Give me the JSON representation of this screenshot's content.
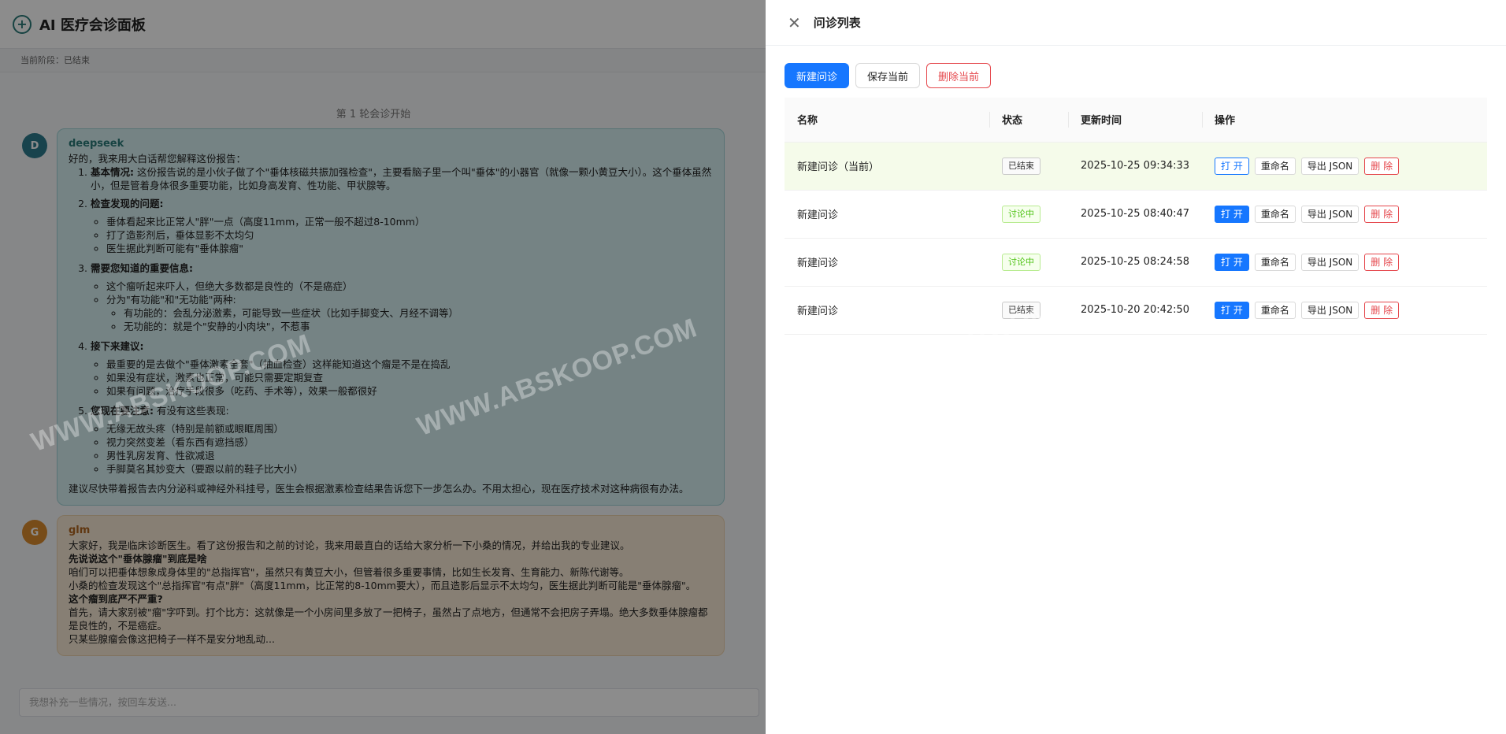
{
  "app": {
    "logo_glyph": "+",
    "title": "AI 医疗会诊面板",
    "stage_text": "当前阶段：已结束",
    "round_label": "第 1 轮会诊开始",
    "input_placeholder": "我想补充一些情况，按回车发送..."
  },
  "messages": {
    "deepseek": {
      "avatar": "D",
      "speaker": "deepseek",
      "intro": "好的，我来用大白话帮您解释这份报告：",
      "s1_title": "基本情况:",
      "s1_text": "这份报告说的是小伙子做了个\"垂体核磁共振加强检查\"，主要看脑子里一个叫\"垂体\"的小器官（就像一颗小黄豆大小）。这个垂体虽然小，但是管着身体很多重要功能，比如身高发育、性功能、甲状腺等。",
      "s2_title": "检查发现的问题:",
      "s2_items": [
        "垂体看起来比正常人\"胖\"一点（高度11mm，正常一般不超过8-10mm）",
        "打了造影剂后，垂体显影不太均匀",
        "医生据此判断可能有\"垂体腺瘤\""
      ],
      "s3_title": "需要您知道的重要信息:",
      "s3_item1": "这个瘤听起来吓人，但绝大多数都是良性的（不是癌症）",
      "s3_item2": "分为\"有功能\"和\"无功能\"两种:",
      "s3_sub": [
        "有功能的：会乱分泌激素，可能导致一些症状（比如手脚变大、月经不调等）",
        "无功能的：就是个\"安静的小肉块\"，不惹事"
      ],
      "s4_title": "接下来建议:",
      "s4_items": [
        "最重要的是去做个\"垂体激素全套\"（抽血检查）这样能知道这个瘤是不是在捣乱",
        "如果没有症状，激素也正常，可能只需要定期复查",
        "如果有问题，治疗手段很多（吃药、手术等），效果一般都很好"
      ],
      "s5_title": "您现在要注意:",
      "s5_text": "有没有这些表现:",
      "s5_items": [
        "无缘无故头疼（特别是前额或眼眶周围）",
        "视力突然变差（看东西有遮挡感）",
        "男性乳房发育、性欲减退",
        "手脚莫名其妙变大（要跟以前的鞋子比大小）"
      ],
      "closing": "建议尽快带着报告去内分泌科或神经外科挂号，医生会根据激素检查结果告诉您下一步怎么办。不用太担心，现在医疗技术对这种病很有办法。"
    },
    "glm": {
      "avatar": "G",
      "speaker": "glm",
      "p1": "大家好，我是临床诊断医生。看了这份报告和之前的讨论，我来用最直白的话给大家分析一下小桑的情况，并给出我的专业建议。",
      "h1": "先说说这个\"垂体腺瘤\"到底是啥",
      "p2": "咱们可以把垂体想象成身体里的\"总指挥官\"，虽然只有黄豆大小，但管着很多重要事情，比如生长发育、生育能力、新陈代谢等。",
      "p3": "小桑的检查发现这个\"总指挥官\"有点\"胖\"（高度11mm，比正常的8-10mm要大），而且造影后显示不太均匀，医生据此判断可能是\"垂体腺瘤\"。",
      "h2": "这个瘤到底严不严重?",
      "p4": "首先，请大家别被\"瘤\"字吓到。打个比方：这就像是一个小房间里多放了一把椅子，虽然占了点地方，但通常不会把房子弄塌。绝大多数垂体腺瘤都是良性的，不是癌症。",
      "p5": "只某些腺瘤会像这把椅子一样不是安分地乱动..."
    }
  },
  "drawer": {
    "title": "问诊列表",
    "toolbar": {
      "new": "新建问诊",
      "save": "保存当前",
      "delete": "删除当前"
    },
    "columns": [
      "名称",
      "状态",
      "更新时间",
      "操作"
    ],
    "rows": [
      {
        "name": "新建问诊（当前）",
        "status": "已结束",
        "updated": "2025-10-25 09:34:33"
      },
      {
        "name": "新建问诊",
        "status": "讨论中",
        "updated": "2025-10-25 08:40:47"
      },
      {
        "name": "新建问诊",
        "status": "讨论中",
        "updated": "2025-10-25 08:24:58"
      },
      {
        "name": "新建问诊",
        "status": "已结束",
        "updated": "2025-10-20 20:42:50"
      }
    ],
    "ops": {
      "open": "打 开",
      "rename": "重命名",
      "export": "导出 JSON",
      "delete": "删 除"
    }
  },
  "watermark": "WWW.ABSKOOP.COM",
  "colors": {
    "primary": "#1677ff",
    "danger": "#e5484d",
    "success": "#52c41a"
  }
}
